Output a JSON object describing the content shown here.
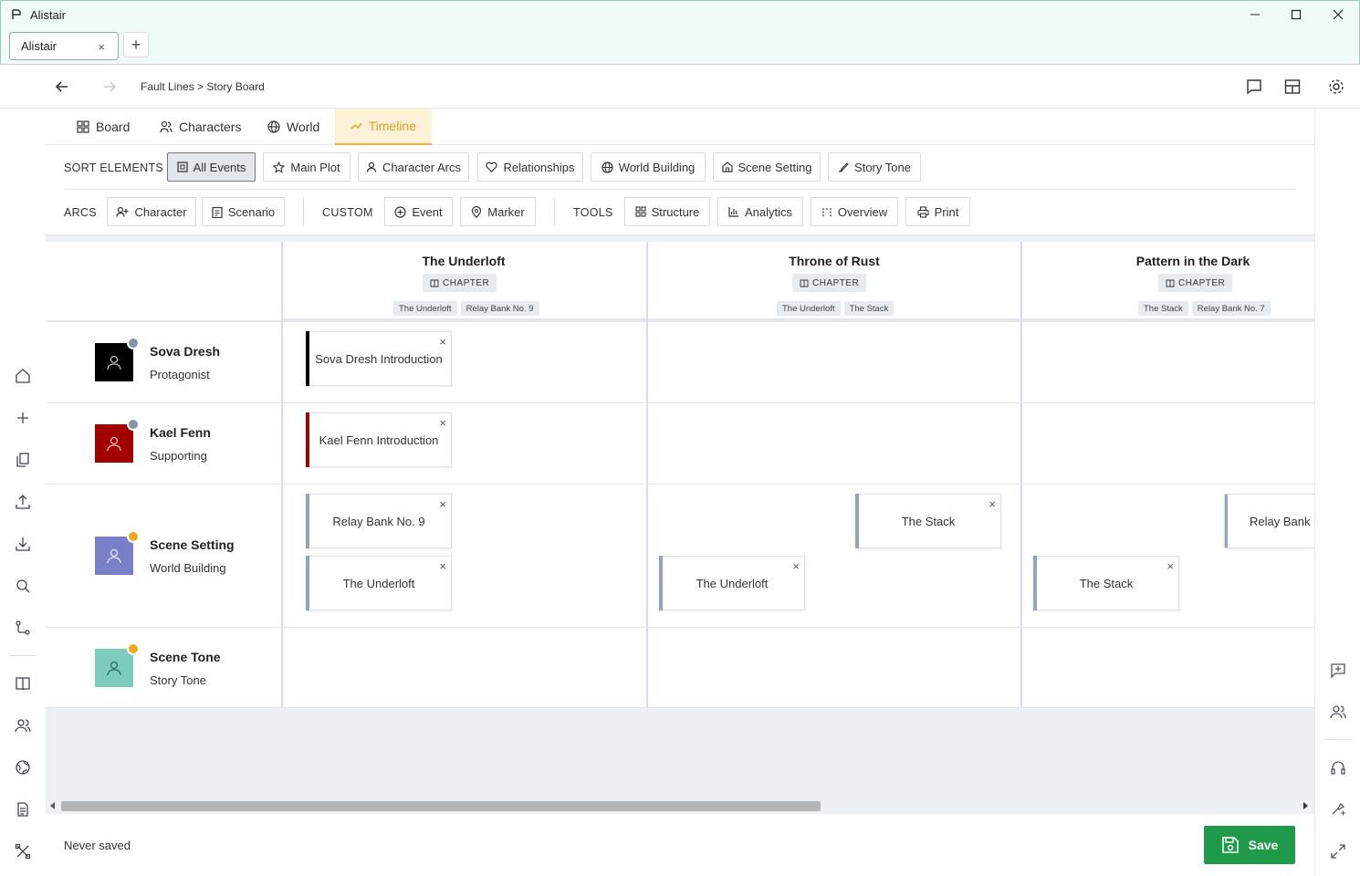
{
  "window": {
    "title": "Alistair"
  },
  "tabs": [
    {
      "label": "Alistair",
      "close": "×"
    }
  ],
  "newtab": "+",
  "breadcrumb": "Fault Lines > Story Board",
  "viewtabs": [
    {
      "label": "Board",
      "icon": "grid-icon"
    },
    {
      "label": "Characters",
      "icon": "users-icon"
    },
    {
      "label": "World",
      "icon": "globe-icon"
    },
    {
      "label": "Timeline",
      "icon": "timeline-icon",
      "active": true
    }
  ],
  "sort": {
    "label": "SORT ELEMENTS",
    "items": [
      "All Events",
      "Main Plot",
      "Character Arcs",
      "Relationships",
      "World Building",
      "Scene Setting",
      "Story Tone"
    ]
  },
  "arcs": {
    "label": "ARCS",
    "items": [
      "Character",
      "Scenario"
    ]
  },
  "custom": {
    "label": "CUSTOM",
    "items": [
      "Event",
      "Marker"
    ]
  },
  "tools": {
    "label": "TOOLS",
    "items": [
      "Structure",
      "Analytics",
      "Overview",
      "Print"
    ]
  },
  "columns": [
    {
      "name": "The Underloft",
      "type": "CHAPTER",
      "tags": [
        "The Underloft",
        "Relay Bank No. 9"
      ]
    },
    {
      "name": "Throne of Rust",
      "type": "CHAPTER",
      "tags": [
        "The Underloft",
        "The Stack"
      ]
    },
    {
      "name": "Pattern in the Dark",
      "type": "CHAPTER",
      "tags": [
        "The Stack",
        "Relay Bank No. 7"
      ]
    }
  ],
  "rows": [
    {
      "name": "Sova Dresh",
      "role": "Protagonist",
      "color": "#000000"
    },
    {
      "name": "Kael Fenn",
      "role": "Supporting",
      "color": "#a30000"
    },
    {
      "name": "Scene Setting",
      "role": "World Building",
      "color": "#7a80c8"
    },
    {
      "name": "Scene Tone",
      "role": "Story Tone",
      "color": "#7dcbbd"
    }
  ],
  "cards": {
    "sova_intro": "Sova Dresh Introduction",
    "kael_intro": "Kael Fenn Introduction",
    "relay9": "Relay Bank No. 9",
    "underloft1": "The Underloft",
    "stack1": "The Stack",
    "underloft2": "The Underloft",
    "relay_n": "Relay Bank N",
    "stack2": "The Stack",
    "close": "×"
  },
  "footer": {
    "status": "Never saved",
    "save": "Save"
  },
  "colors": {
    "accent": "#f0b23a",
    "save": "#1f9a4a",
    "card_bar_setting": "#95a3bf"
  }
}
